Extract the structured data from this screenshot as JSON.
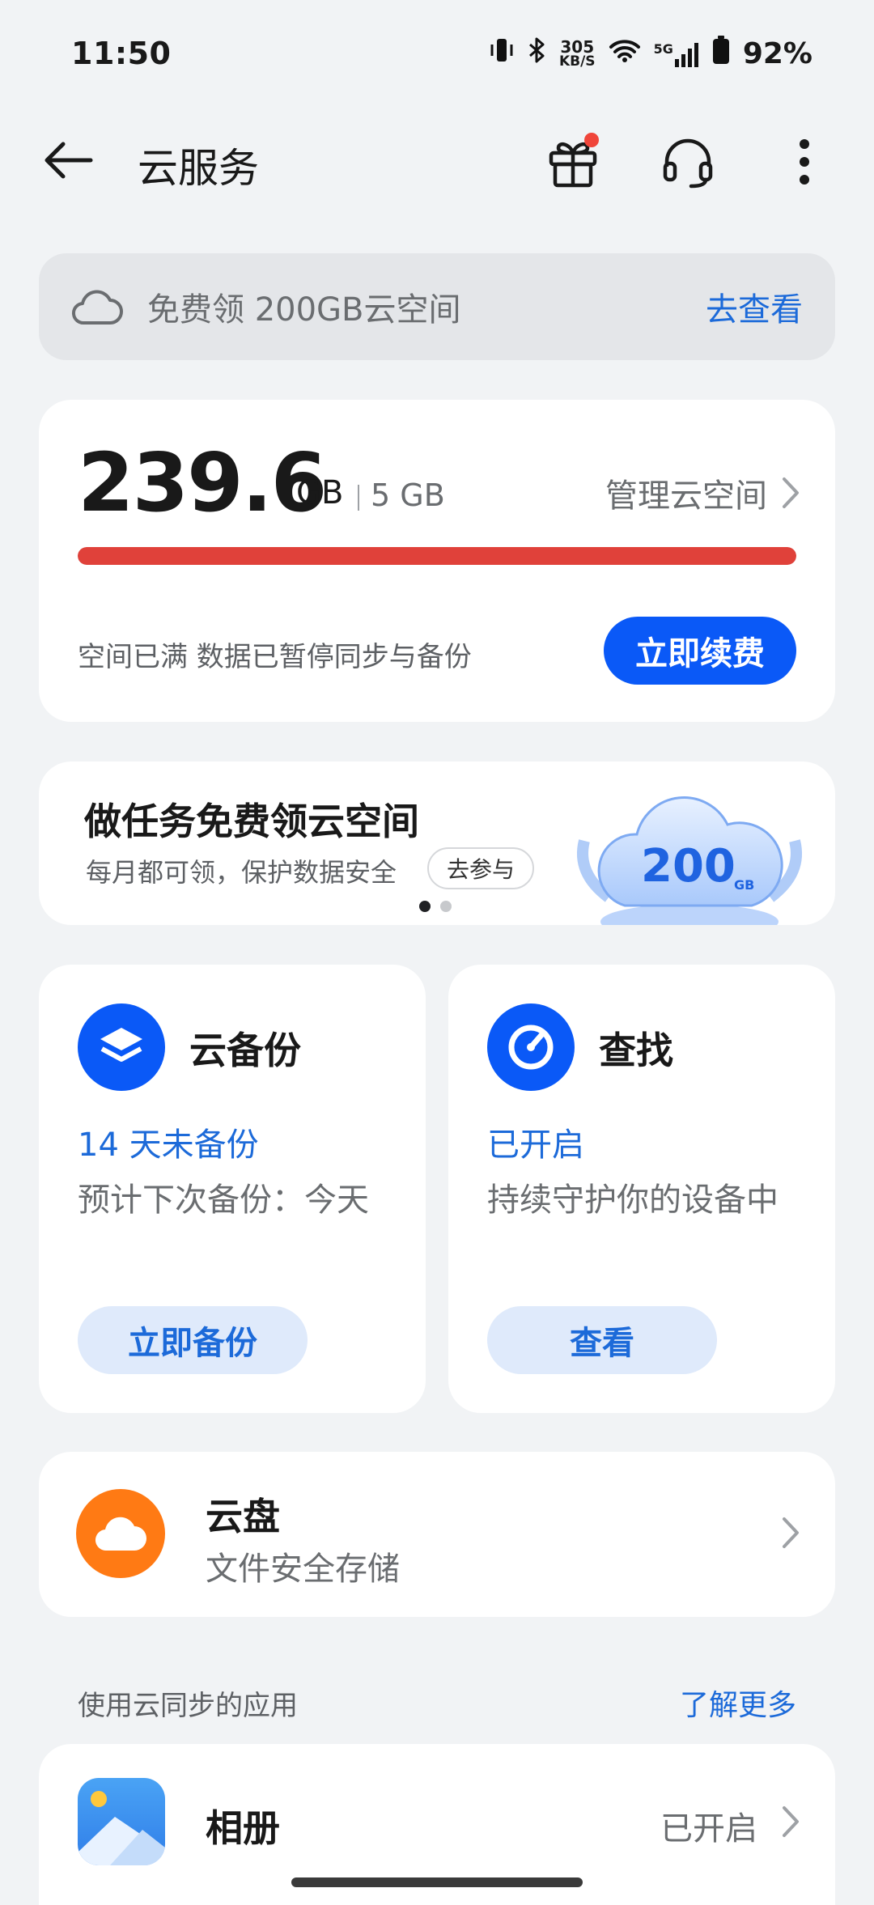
{
  "status_bar": {
    "time": "11:50",
    "net_speed_value": "305",
    "net_speed_unit": "KB/S",
    "network": "5G",
    "battery": "92%"
  },
  "header": {
    "title": "云服务"
  },
  "promo": {
    "text": "免费领 200GB云空间",
    "link": "去查看"
  },
  "storage": {
    "used": "239.6",
    "unit": "GB",
    "quota": "5 GB",
    "manage_label": "管理云空间",
    "usage_fraction": 1.0,
    "message": "空间已满 数据已暂停同步与备份",
    "renew_label": "立即续费",
    "bar_color": "#e0413a"
  },
  "task": {
    "title": "做任务免费领云空间",
    "subtitle": "每月都可领，保护数据安全",
    "button": "去参与",
    "art_text": "200",
    "art_unit": "GB"
  },
  "backup": {
    "title": "云备份",
    "status": "14 天未备份",
    "desc": "预计下次备份：今天",
    "button": "立即备份"
  },
  "find": {
    "title": "查找",
    "status": "已开启",
    "desc": "持续守护你的设备中",
    "button": "查看"
  },
  "drive": {
    "title": "云盘",
    "subtitle": "文件安全存储"
  },
  "apps_section": {
    "title": "使用云同步的应用",
    "link": "了解更多"
  },
  "album": {
    "title": "相册",
    "status": "已开启"
  },
  "colors": {
    "accent": "#0a59f7",
    "link": "#1c6ad9",
    "warning": "#e0413a",
    "drive": "#ff7a14"
  }
}
